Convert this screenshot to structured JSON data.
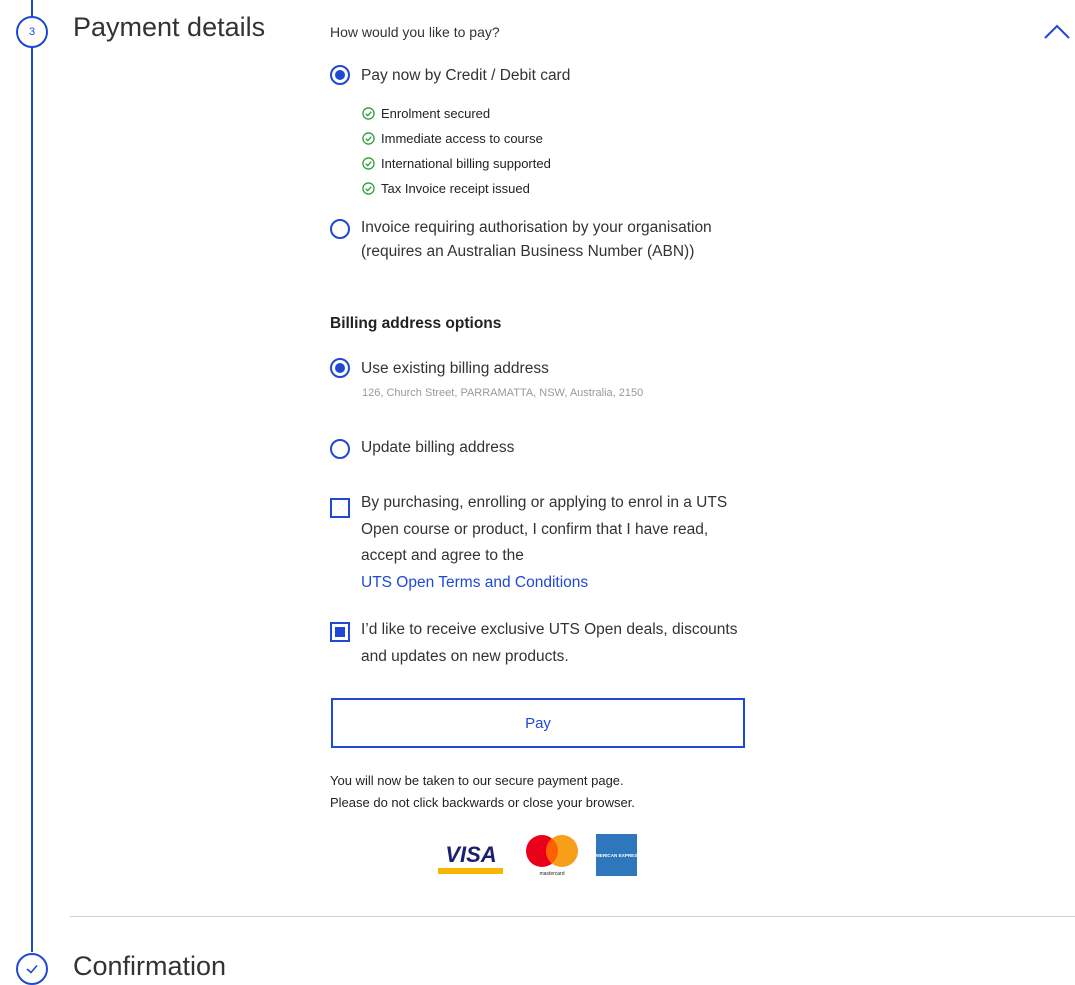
{
  "steps": {
    "payment": {
      "number": "3",
      "title": "Payment details"
    },
    "confirmation": {
      "title": "Confirmation"
    }
  },
  "payment": {
    "question": "How would you like to pay?",
    "options": [
      {
        "label": "Pay now by Credit / Debit card",
        "selected": true
      },
      {
        "label": "Invoice requiring authorisation by your organisation (requires an Australian Business Number (ABN))",
        "selected": false
      }
    ],
    "benefits": [
      "Enrolment secured",
      "Immediate access to course",
      "International billing supported",
      "Tax Invoice receipt issued"
    ]
  },
  "billing": {
    "heading": "Billing address options",
    "options": [
      {
        "label": "Use existing billing address",
        "selected": true,
        "address": "126, Church Street, PARRAMATTA, NSW, Australia, 2150"
      },
      {
        "label": "Update billing address",
        "selected": false
      }
    ]
  },
  "agreements": {
    "terms": {
      "text": "By purchasing, enrolling or applying to enrol in a UTS Open course or product, I confirm that I have read, accept and agree to the",
      "link": "UTS Open Terms and Conditions",
      "checked": false
    },
    "marketing": {
      "text": "I’d like to receive exclusive UTS Open deals, discounts and updates on new products.",
      "checked": true
    }
  },
  "pay_button": "Pay",
  "notice": {
    "line1": "You will now be taken to our secure payment page.",
    "line2": "Please do not click backwards or close your browser."
  },
  "card_logos": {
    "visa": "VISA",
    "mastercard": "mastercard",
    "amex": "AMERICAN EXPRESS"
  },
  "colors": {
    "accent": "#1e48d6",
    "success": "#2e9e3a",
    "divider": "#d0d0d0"
  },
  "icons": [
    "step-number-icon",
    "chevron-up-icon",
    "check-circle-icon",
    "check-icon"
  ]
}
